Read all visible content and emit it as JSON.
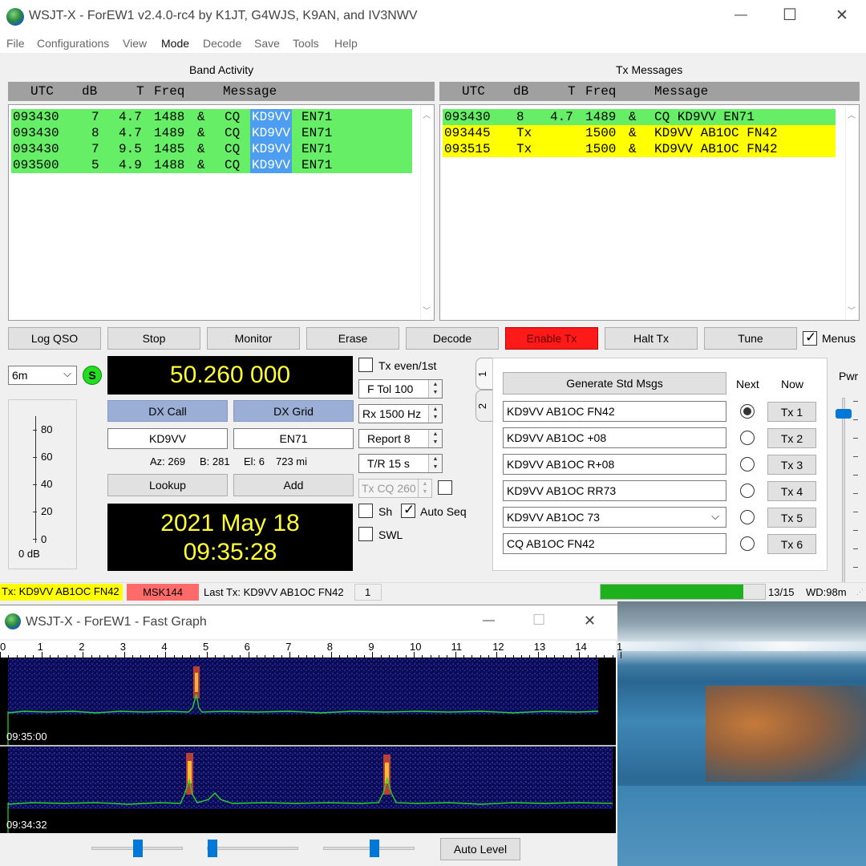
{
  "app": {
    "title": "WSJT-X - ForEW1   v2.4.0-rc4   by K1JT, G4WJS, K9AN, and IV3NWV",
    "menu": [
      "File",
      "Configurations",
      "View",
      "Mode",
      "Decode",
      "Save",
      "Tools",
      "Help"
    ],
    "window_controls": {
      "min": "—",
      "max": "☐",
      "close": "✕"
    }
  },
  "band_activity": {
    "title": "Band Activity",
    "headers": {
      "utc": "UTC",
      "db": "dB",
      "t": "T",
      "freq": "Freq",
      "msg": "Message"
    },
    "rows": [
      {
        "utc": "093430",
        "db": "7",
        "t": "4.7",
        "freq": "1488",
        "amp": "&",
        "cq": "CQ",
        "call": "KD9VV",
        "grid": "EN71"
      },
      {
        "utc": "093430",
        "db": "8",
        "t": "4.7",
        "freq": "1489",
        "amp": "&",
        "cq": "CQ",
        "call": "KD9VV",
        "grid": "EN71"
      },
      {
        "utc": "093430",
        "db": "7",
        "t": "9.5",
        "freq": "1485",
        "amp": "&",
        "cq": "CQ",
        "call": "KD9VV",
        "grid": "EN71"
      },
      {
        "utc": "093500",
        "db": "5",
        "t": "4.9",
        "freq": "1488",
        "amp": "&",
        "cq": "CQ",
        "call": "KD9VV",
        "grid": "EN71"
      }
    ]
  },
  "tx_messages": {
    "title": "Tx Messages",
    "headers": {
      "utc": "UTC",
      "db": "dB",
      "t": "T",
      "freq": "Freq",
      "msg": "Message"
    },
    "rows": [
      {
        "utc": "093430",
        "db": "8",
        "t": "4.7",
        "freq": "1489",
        "amp": "&",
        "msg": "CQ KD9VV EN71",
        "color": "#66ee66"
      },
      {
        "utc": "093445",
        "db": "Tx",
        "t": "",
        "freq": "1500",
        "amp": "&",
        "msg": "KD9VV AB1OC FN42",
        "color": "#ffff00"
      },
      {
        "utc": "093515",
        "db": "Tx",
        "t": "",
        "freq": "1500",
        "amp": "&",
        "msg": "KD9VV AB1OC FN42",
        "color": "#ffff00"
      }
    ]
  },
  "buttons": {
    "log_qso": "Log QSO",
    "stop": "Stop",
    "monitor": "Monitor",
    "erase": "Erase",
    "decode": "Decode",
    "enable_tx": "Enable Tx",
    "halt_tx": "Halt Tx",
    "tune": "Tune",
    "menus": "Menus"
  },
  "left": {
    "band": "6m",
    "s_label": "S",
    "frequency": "50.260 000",
    "dx_call_btn": "DX Call",
    "dx_grid_btn": "DX Grid",
    "dx_call": "KD9VV",
    "dx_grid": "EN71",
    "az": "Az: 269",
    "b": "B: 281",
    "el": "El: 6",
    "dist": "723 mi",
    "lookup": "Lookup",
    "add": "Add",
    "date": "2021 May 18",
    "time": "09:35:28",
    "meter_ticks": [
      "80",
      "60",
      "40",
      "20",
      "0"
    ],
    "meter_db": "0 dB"
  },
  "mid": {
    "tx_even": "Tx even/1st",
    "ftol": "F Tol  100",
    "rx": "Rx  1500  Hz",
    "report": "Report  8",
    "tr": "T/R  15  s",
    "txcq": "Tx CQ  260",
    "sh": "Sh",
    "autoseq": "Auto Seq",
    "swl": "SWL"
  },
  "tx_panel": {
    "tabs": [
      "1",
      "2"
    ],
    "generate": "Generate Std Msgs",
    "next": "Next",
    "now": "Now",
    "pwr": "Pwr",
    "msgs": [
      "KD9VV AB1OC FN42",
      "KD9VV AB1OC +08",
      "KD9VV AB1OC R+08",
      "KD9VV AB1OC RR73",
      "KD9VV AB1OC 73",
      "CQ AB1OC FN42"
    ],
    "tx_buttons": [
      "Tx 1",
      "Tx 2",
      "Tx 3",
      "Tx 4",
      "Tx 5",
      "Tx 6"
    ],
    "selected_next": 0
  },
  "status": {
    "tx": "Tx: KD9VV AB1OC FN42",
    "mode": "MSK144",
    "last_tx": "Last Tx: KD9VV AB1OC FN42",
    "count": "1",
    "seq": "13/15",
    "wd": "WD:98m",
    "progress": 0.87
  },
  "fast_graph": {
    "title": "WSJT-X - ForEW1 - Fast Graph",
    "ticks": [
      "0",
      "1",
      "2",
      "3",
      "4",
      "5",
      "6",
      "7",
      "8",
      "9",
      "10",
      "11",
      "12",
      "13",
      "14",
      "1"
    ],
    "time1": "09:35:00",
    "time2": "09:34:32",
    "auto_level": "Auto Level"
  },
  "colors": {
    "green_row": "#66ee66",
    "yellow_row": "#ffff00",
    "call_highlight": "#4d9ef0",
    "enable_tx": "#ff1a1a",
    "freq_text": "#ffff33",
    "dx_btn": "#9aaed6"
  }
}
